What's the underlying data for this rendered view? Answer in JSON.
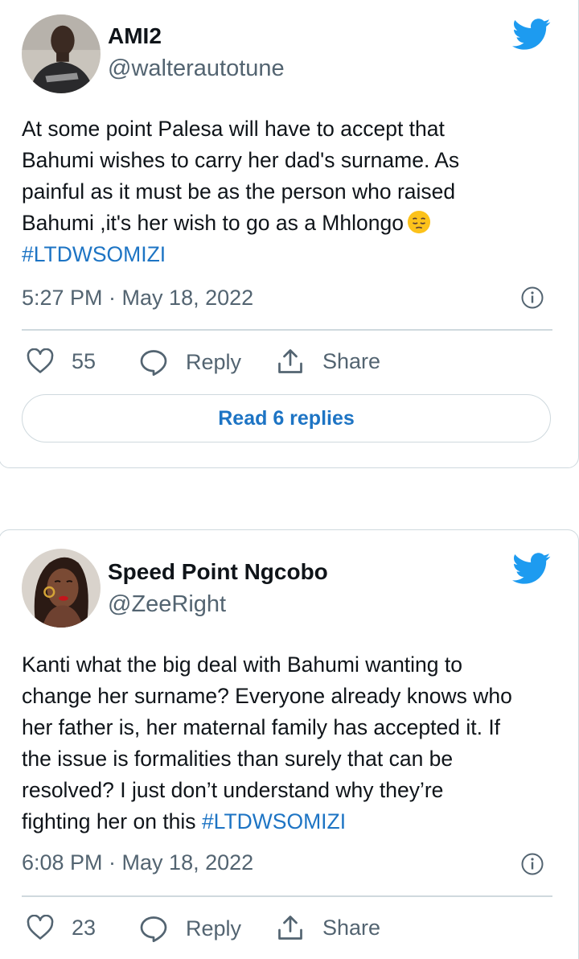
{
  "tweets": [
    {
      "author_name": "AMI2",
      "author_handle": "@walterautotune",
      "avatar": "person-dark-shirt-avatar",
      "body_lines": [
        "At some point Palesa will have to accept that",
        "Bahumi wishes to carry her dad's surname. As",
        "painful as it must be as the person who raised",
        "Bahumi ,it's her wish to go as a Mhlongo"
      ],
      "body_emoji": "pensive-face-emoji",
      "hashtag": "#LTDWSOMIZI",
      "timestamp": "5:27 PM · May 18, 2022",
      "like_count": "55",
      "reply_label": "Reply",
      "share_label": "Share",
      "read_replies_label": "Read 6 replies"
    },
    {
      "author_name": "Speed Point Ngcobo",
      "author_handle": "@ZeeRight",
      "avatar": "woman-red-lips-avatar",
      "body_lines": [
        "Kanti what the big deal with Bahumi wanting to",
        "change her surname? Everyone already knows who",
        "her father is, her maternal family has accepted it. If",
        "the issue is formalities than surely that can be",
        "resolved? I just don’t understand why they’re",
        "fighting her on this"
      ],
      "hashtag": "#LTDWSOMIZI",
      "timestamp": "6:08 PM · May 18, 2022",
      "like_count": "23",
      "reply_label": "Reply",
      "share_label": "Share"
    }
  ],
  "colors": {
    "twitter_blue": "#1d9bf0",
    "link_blue": "#1d74c4",
    "secondary_text": "#536471",
    "border": "#cfd9de"
  }
}
